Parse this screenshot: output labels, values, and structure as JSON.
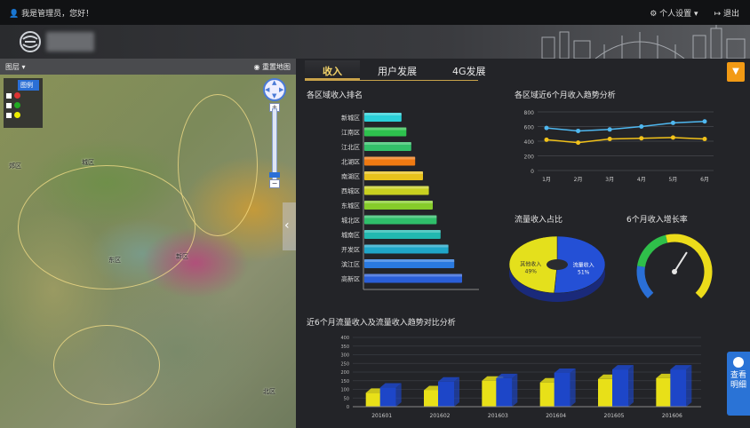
{
  "topbar": {
    "user_text": "我是管理员，您好！",
    "settings_label": "个人设置",
    "logout_label": "退出"
  },
  "map": {
    "toolbar_layers_label": "图层",
    "toolbar_reset_label": "重置地图",
    "legend_header": "图例",
    "labels": [
      "城区",
      "郊区",
      "新区",
      "东区",
      "北区"
    ]
  },
  "tabs": [
    {
      "label": "收入",
      "active": true
    },
    {
      "label": "用户发展",
      "active": false
    },
    {
      "label": "4G发展",
      "active": false
    }
  ],
  "side_button": {
    "label": "查看明细"
  },
  "charts": {
    "hbar_title": "各区域收入排名",
    "line_title": "各区域近6个月收入趋势分析",
    "pie_title": "流量收入占比",
    "gauge_title": "6个月收入增长率",
    "vbar_title": "近6个月流量收入及流量收入趋势对比分析"
  },
  "chart_data": [
    {
      "type": "bar",
      "orientation": "horizontal",
      "title": "各区域收入排名",
      "categories": [
        "高新区",
        "滨江区",
        "开发区",
        "城南区",
        "城北区",
        "东城区",
        "西城区",
        "南湖区",
        "北湖区",
        "江北区",
        "江南区",
        "新城区"
      ],
      "values": [
        100,
        92,
        86,
        78,
        74,
        70,
        66,
        60,
        52,
        48,
        43,
        38
      ],
      "colors": [
        "#2a5ed8",
        "#2a7ae0",
        "#1fa6c8",
        "#22b8b0",
        "#2fbf6a",
        "#86cc2a",
        "#c8d020",
        "#e8c21c",
        "#f07a12",
        "#33c06a",
        "#2ec24e",
        "#2ad0d8"
      ]
    },
    {
      "type": "line",
      "title": "各区域近6个月收入趋势分析",
      "categories": [
        "1月",
        "2月",
        "3月",
        "4月",
        "5月",
        "6月"
      ],
      "ylim": [
        0,
        800
      ],
      "yticks": [
        0,
        200,
        400,
        600,
        800
      ],
      "series": [
        {
          "values": [
            580,
            540,
            560,
            600,
            650,
            670
          ],
          "color": "#4fb8f0"
        },
        {
          "values": [
            420,
            380,
            430,
            440,
            450,
            430
          ],
          "color": "#f2c21a"
        }
      ]
    },
    {
      "type": "pie",
      "title": "流量收入占比",
      "slices": [
        {
          "label": "流量收入",
          "value": 51,
          "color": "#2450d6"
        },
        {
          "label": "其他收入",
          "value": 49,
          "color": "#e4e01c"
        }
      ]
    },
    {
      "type": "gauge",
      "title": "6个月收入增长率",
      "value": 62,
      "max": 100
    },
    {
      "type": "bar",
      "title": "近6个月流量收入及流量收入趋势对比分析",
      "categories": [
        "201601",
        "201602",
        "201603",
        "201604",
        "201605",
        "201606"
      ],
      "ylim": [
        0,
        400
      ],
      "yticks": [
        0,
        50,
        100,
        150,
        200,
        250,
        300,
        350,
        400
      ],
      "series": [
        {
          "values": [
            80,
            95,
            150,
            140,
            160,
            165
          ],
          "color": "#e8e018"
        },
        {
          "values": [
            110,
            145,
            165,
            195,
            215,
            215
          ],
          "color": "#1d46c8"
        }
      ]
    }
  ]
}
